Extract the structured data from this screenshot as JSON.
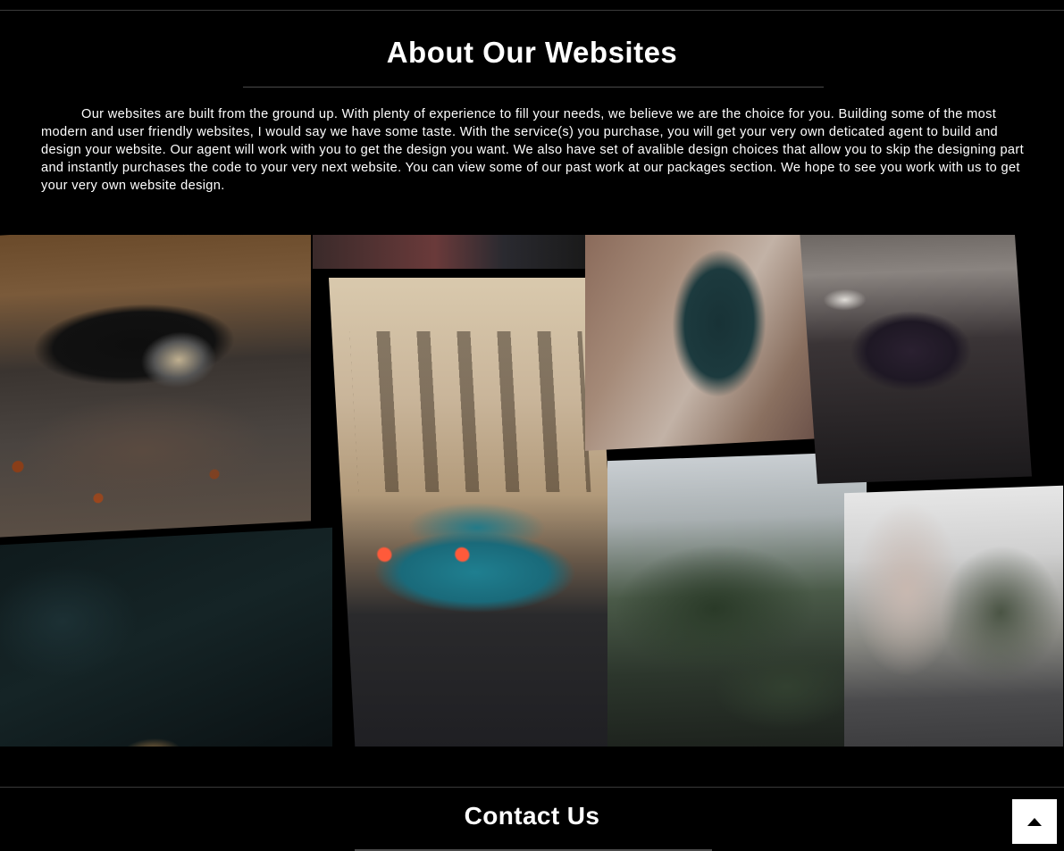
{
  "about": {
    "title": "About Our Websites",
    "text": "Our websites are built from the ground up. With plenty of experience to fill your needs, we believe we are the choice for you. Building some of the most modern and user friendly websites, I would say we have some taste. With the service(s) you purchase, you will get your very own deticated agent to build and design your website. Our agent will work with you to get the design you want. We also have set of avalible design choices that allow you to skip the designing part and instantly purchases the code to your very next website. You can view some of our past work at our packages section. We hope to see you work with us to get your very own website design."
  },
  "gallery": {
    "images": [
      {
        "name": "porsche-autumn"
      },
      {
        "name": "dark-teal-abstract"
      },
      {
        "name": "red-blur-strip"
      },
      {
        "name": "teal-skyline-building"
      },
      {
        "name": "overhead-green-car"
      },
      {
        "name": "blurred-trees"
      },
      {
        "name": "purple-gtr"
      },
      {
        "name": "city-street"
      }
    ]
  },
  "contact": {
    "title": "Contact Us"
  },
  "scroll_top": {
    "icon": "arrow-up-icon"
  }
}
